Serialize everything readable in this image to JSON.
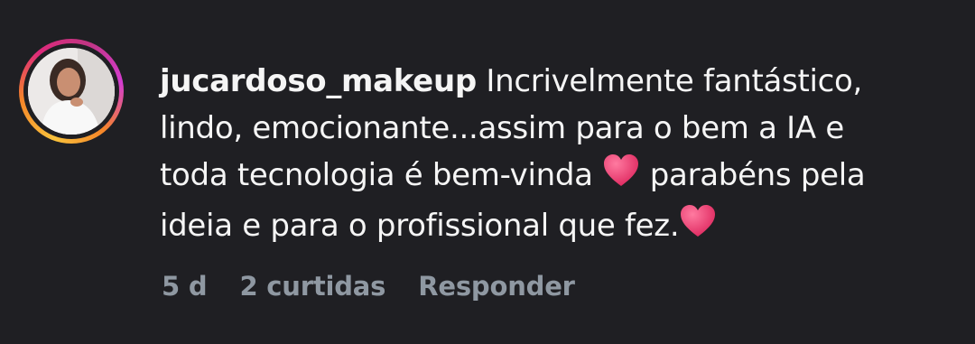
{
  "comment": {
    "username": "jucardoso_makeup",
    "text_line1": "Incrivelmente fantástico,",
    "text_line2": "lindo, emocionante...assim para o bem a IA e",
    "text_line3a": "toda tecnologia é bem-vinda",
    "text_line3b": "parabéns pela",
    "text_line4": "ideia e para o profissional que fez.",
    "heart_icon": "heart-emoji",
    "heart_color": "#f0447a"
  },
  "meta": {
    "time": "5 d",
    "likes": "2 curtidas",
    "reply": "Responder"
  },
  "colors": {
    "background": "#1f1f23",
    "text": "#f5f5f5",
    "meta_text": "#8f98a2"
  }
}
